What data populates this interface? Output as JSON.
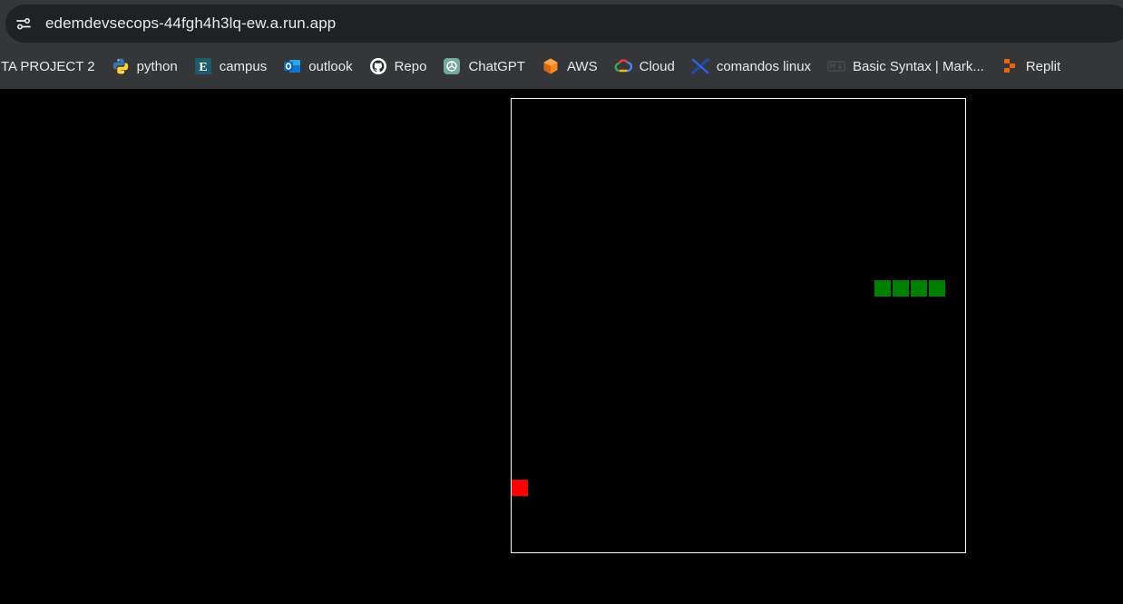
{
  "browser": {
    "address_bar": {
      "url": "edemdevsecops-44fgh4h3lq-ew.a.run.app"
    },
    "bookmarks": [
      {
        "label": "TA PROJECT 2",
        "icon": "none"
      },
      {
        "label": "python",
        "icon": "python-icon"
      },
      {
        "label": "campus",
        "icon": "campus-e-icon"
      },
      {
        "label": "outlook",
        "icon": "outlook-icon"
      },
      {
        "label": "Repo",
        "icon": "github-icon"
      },
      {
        "label": "ChatGPT",
        "icon": "chatgpt-icon"
      },
      {
        "label": "AWS",
        "icon": "aws-icon"
      },
      {
        "label": "Cloud",
        "icon": "google-cloud-icon"
      },
      {
        "label": "comandos linux",
        "icon": "x-logo-icon"
      },
      {
        "label": "Basic Syntax | Mark...",
        "icon": "markdown-icon"
      },
      {
        "label": "Replit",
        "icon": "replit-icon"
      }
    ]
  },
  "game": {
    "grid_size": 25,
    "snake_color": "#008000",
    "food_color": "#ff0000",
    "border_color": "#ffffff",
    "snake": [
      {
        "col": 20,
        "row": 10
      },
      {
        "col": 21,
        "row": 10
      },
      {
        "col": 22,
        "row": 10
      },
      {
        "col": 23,
        "row": 10
      }
    ],
    "food": {
      "col": 0,
      "row": 21
    }
  }
}
